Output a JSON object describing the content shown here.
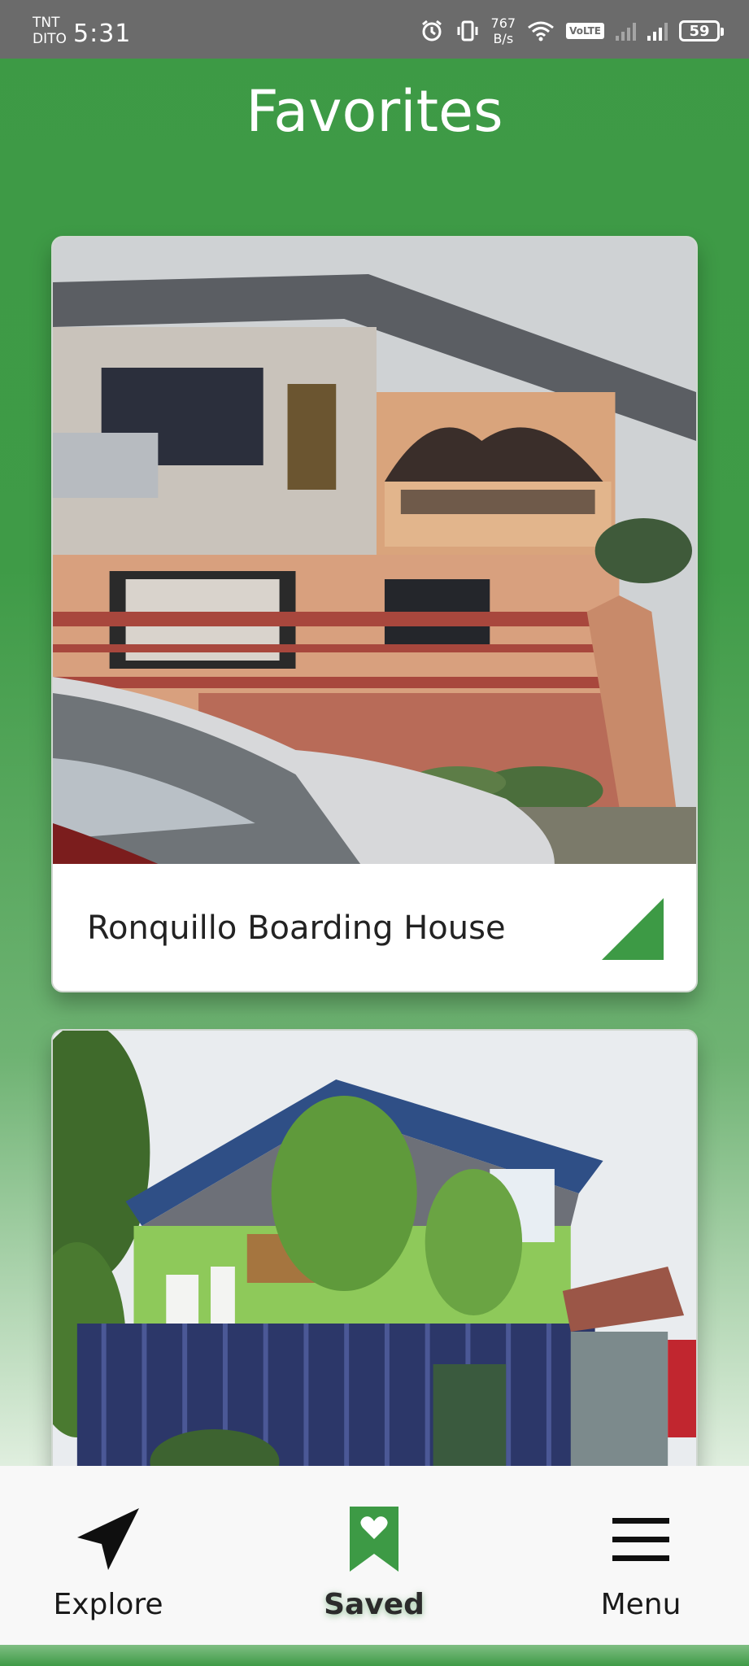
{
  "status_bar": {
    "carrier_1": "TNT",
    "carrier_2": "DITO",
    "time": "5:31",
    "net_speed_value": "767",
    "net_speed_unit": "B/s",
    "volte": "VoLTE",
    "battery": "59",
    "icons": [
      "alarm-icon",
      "vibrate-icon",
      "wifi-icon",
      "signal-icon",
      "signal-icon",
      "battery-icon"
    ]
  },
  "page": {
    "title": "Favorites"
  },
  "favorites": [
    {
      "name": "Ronquillo Boarding House",
      "image": "two-story house photo"
    },
    {
      "name": "",
      "image": "green two-story house photo"
    }
  ],
  "bottom_nav": {
    "items": [
      {
        "label": "Explore",
        "icon": "navigation-arrow-icon",
        "active": false
      },
      {
        "label": "Saved",
        "icon": "bookmark-heart-icon",
        "active": true
      },
      {
        "label": "Menu",
        "icon": "hamburger-menu-icon",
        "active": false
      }
    ]
  },
  "colors": {
    "primary_green": "#3d9a45",
    "nav_background": "#f8f8f8",
    "status_bar": "#6b6b6b"
  }
}
